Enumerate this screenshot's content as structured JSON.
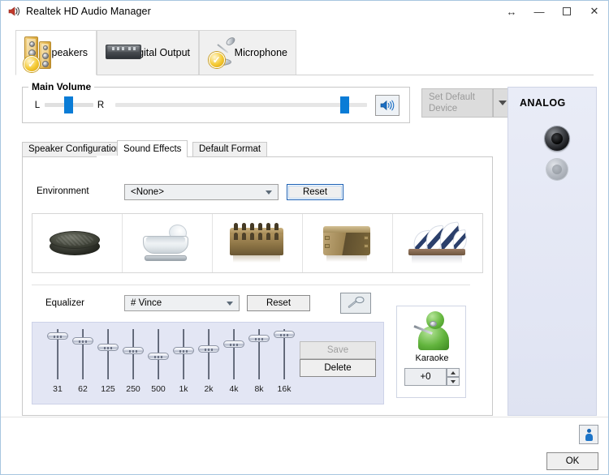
{
  "window": {
    "title": "Realtek HD Audio Manager",
    "icon": "speaker-icon",
    "controls": {
      "resize": "↔",
      "minimize": "—",
      "maximize": "",
      "close": "✕"
    }
  },
  "device_tabs": [
    {
      "label": "Speakers",
      "icon": "speakers-icon",
      "active": true
    },
    {
      "label": "Digital Output",
      "icon": "digital-output-icon",
      "active": false
    },
    {
      "label": "Microphone",
      "icon": "microphone-icon",
      "active": false
    }
  ],
  "main_volume": {
    "legend": "Main Volume",
    "left_label": "L",
    "right_label": "R",
    "balance_percent": 50,
    "volume_percent": 93,
    "mute_button_icon": "speaker-volume-icon"
  },
  "set_default_device": {
    "label": "Set Default\nDevice",
    "line1": "Set Default",
    "line2": "Device",
    "disabled": true,
    "dropdown_icon": "chevron-down-icon"
  },
  "inner_tabs": [
    {
      "label": "Speaker Configuration",
      "active": false
    },
    {
      "label": "Sound Effects",
      "active": true
    },
    {
      "label": "Default Format",
      "active": false
    }
  ],
  "environment": {
    "label": "Environment",
    "selected": "<None>",
    "reset_label": "Reset",
    "reset_focused": true,
    "presets": [
      {
        "name": "Sewer Pipe",
        "icon": "sewer-pipe-thumbnail"
      },
      {
        "name": "Bathroom",
        "icon": "bathroom-thumbnail"
      },
      {
        "name": "Stone Room",
        "icon": "colosseum-thumbnail"
      },
      {
        "name": "Arena",
        "icon": "arena-thumbnail"
      },
      {
        "name": "Concert Hall",
        "icon": "opera-house-thumbnail"
      }
    ]
  },
  "equalizer": {
    "label": "Equalizer",
    "selected": "# Vince",
    "reset_label": "Reset",
    "tool_icon": "tuning-fork-icon",
    "save_label": "Save",
    "save_disabled": true,
    "delete_label": "Delete",
    "bands": [
      {
        "freq": "31",
        "value": 92
      },
      {
        "freq": "62",
        "value": 82
      },
      {
        "freq": "125",
        "value": 66
      },
      {
        "freq": "250",
        "value": 58
      },
      {
        "freq": "500",
        "value": 45
      },
      {
        "freq": "1k",
        "value": 58
      },
      {
        "freq": "2k",
        "value": 62
      },
      {
        "freq": "4k",
        "value": 74
      },
      {
        "freq": "8k",
        "value": 86
      },
      {
        "freq": "16k",
        "value": 96
      }
    ]
  },
  "karaoke": {
    "label": "Karaoke",
    "icon": "karaoke-person-icon",
    "value": "+0",
    "up_icon": "spinner-up-icon",
    "down_icon": "spinner-down-icon"
  },
  "analog_panel": {
    "title": "ANALOG",
    "jacks": [
      {
        "name": "line-out-jack",
        "state": "connected",
        "color": "#17181b"
      },
      {
        "name": "mic-in-jack",
        "state": "disconnected",
        "color": "#949aa3"
      }
    ]
  },
  "footer": {
    "info_icon": "information-icon",
    "ok_label": "OK"
  },
  "colors": {
    "accent": "#0a7cd6",
    "panel": "#e3e6f4",
    "analog_bg": "#e9ecf7",
    "speaker_gold": "#e8bd5a",
    "karaoke_green": "#62b43d"
  }
}
